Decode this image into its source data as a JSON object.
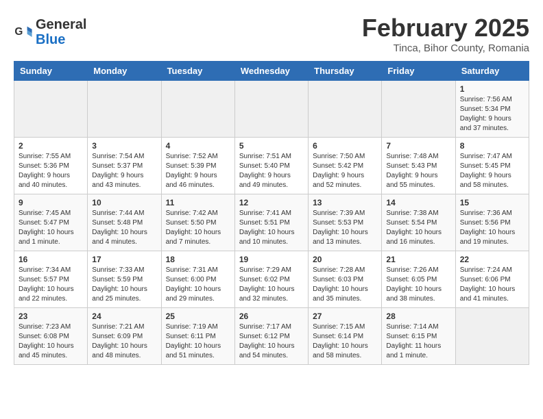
{
  "logo": {
    "text_general": "General",
    "text_blue": "Blue"
  },
  "title": "February 2025",
  "subtitle": "Tinca, Bihor County, Romania",
  "days_of_week": [
    "Sunday",
    "Monday",
    "Tuesday",
    "Wednesday",
    "Thursday",
    "Friday",
    "Saturday"
  ],
  "weeks": [
    [
      {
        "day": "",
        "info": ""
      },
      {
        "day": "",
        "info": ""
      },
      {
        "day": "",
        "info": ""
      },
      {
        "day": "",
        "info": ""
      },
      {
        "day": "",
        "info": ""
      },
      {
        "day": "",
        "info": ""
      },
      {
        "day": "1",
        "info": "Sunrise: 7:56 AM\nSunset: 5:34 PM\nDaylight: 9 hours and 37 minutes."
      }
    ],
    [
      {
        "day": "2",
        "info": "Sunrise: 7:55 AM\nSunset: 5:36 PM\nDaylight: 9 hours and 40 minutes."
      },
      {
        "day": "3",
        "info": "Sunrise: 7:54 AM\nSunset: 5:37 PM\nDaylight: 9 hours and 43 minutes."
      },
      {
        "day": "4",
        "info": "Sunrise: 7:52 AM\nSunset: 5:39 PM\nDaylight: 9 hours and 46 minutes."
      },
      {
        "day": "5",
        "info": "Sunrise: 7:51 AM\nSunset: 5:40 PM\nDaylight: 9 hours and 49 minutes."
      },
      {
        "day": "6",
        "info": "Sunrise: 7:50 AM\nSunset: 5:42 PM\nDaylight: 9 hours and 52 minutes."
      },
      {
        "day": "7",
        "info": "Sunrise: 7:48 AM\nSunset: 5:43 PM\nDaylight: 9 hours and 55 minutes."
      },
      {
        "day": "8",
        "info": "Sunrise: 7:47 AM\nSunset: 5:45 PM\nDaylight: 9 hours and 58 minutes."
      }
    ],
    [
      {
        "day": "9",
        "info": "Sunrise: 7:45 AM\nSunset: 5:47 PM\nDaylight: 10 hours and 1 minute."
      },
      {
        "day": "10",
        "info": "Sunrise: 7:44 AM\nSunset: 5:48 PM\nDaylight: 10 hours and 4 minutes."
      },
      {
        "day": "11",
        "info": "Sunrise: 7:42 AM\nSunset: 5:50 PM\nDaylight: 10 hours and 7 minutes."
      },
      {
        "day": "12",
        "info": "Sunrise: 7:41 AM\nSunset: 5:51 PM\nDaylight: 10 hours and 10 minutes."
      },
      {
        "day": "13",
        "info": "Sunrise: 7:39 AM\nSunset: 5:53 PM\nDaylight: 10 hours and 13 minutes."
      },
      {
        "day": "14",
        "info": "Sunrise: 7:38 AM\nSunset: 5:54 PM\nDaylight: 10 hours and 16 minutes."
      },
      {
        "day": "15",
        "info": "Sunrise: 7:36 AM\nSunset: 5:56 PM\nDaylight: 10 hours and 19 minutes."
      }
    ],
    [
      {
        "day": "16",
        "info": "Sunrise: 7:34 AM\nSunset: 5:57 PM\nDaylight: 10 hours and 22 minutes."
      },
      {
        "day": "17",
        "info": "Sunrise: 7:33 AM\nSunset: 5:59 PM\nDaylight: 10 hours and 25 minutes."
      },
      {
        "day": "18",
        "info": "Sunrise: 7:31 AM\nSunset: 6:00 PM\nDaylight: 10 hours and 29 minutes."
      },
      {
        "day": "19",
        "info": "Sunrise: 7:29 AM\nSunset: 6:02 PM\nDaylight: 10 hours and 32 minutes."
      },
      {
        "day": "20",
        "info": "Sunrise: 7:28 AM\nSunset: 6:03 PM\nDaylight: 10 hours and 35 minutes."
      },
      {
        "day": "21",
        "info": "Sunrise: 7:26 AM\nSunset: 6:05 PM\nDaylight: 10 hours and 38 minutes."
      },
      {
        "day": "22",
        "info": "Sunrise: 7:24 AM\nSunset: 6:06 PM\nDaylight: 10 hours and 41 minutes."
      }
    ],
    [
      {
        "day": "23",
        "info": "Sunrise: 7:23 AM\nSunset: 6:08 PM\nDaylight: 10 hours and 45 minutes."
      },
      {
        "day": "24",
        "info": "Sunrise: 7:21 AM\nSunset: 6:09 PM\nDaylight: 10 hours and 48 minutes."
      },
      {
        "day": "25",
        "info": "Sunrise: 7:19 AM\nSunset: 6:11 PM\nDaylight: 10 hours and 51 minutes."
      },
      {
        "day": "26",
        "info": "Sunrise: 7:17 AM\nSunset: 6:12 PM\nDaylight: 10 hours and 54 minutes."
      },
      {
        "day": "27",
        "info": "Sunrise: 7:15 AM\nSunset: 6:14 PM\nDaylight: 10 hours and 58 minutes."
      },
      {
        "day": "28",
        "info": "Sunrise: 7:14 AM\nSunset: 6:15 PM\nDaylight: 11 hours and 1 minute."
      },
      {
        "day": "",
        "info": ""
      }
    ]
  ]
}
